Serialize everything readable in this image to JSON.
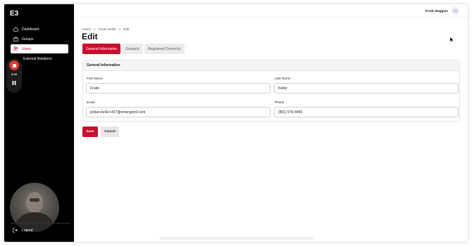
{
  "app": {
    "logo_text": "E3"
  },
  "sidebar": {
    "items": [
      {
        "label": "Dashboard",
        "icon": "home-icon"
      },
      {
        "label": "Groups",
        "icon": "groups-icon"
      },
      {
        "label": "Users",
        "icon": "users-icon",
        "active": true
      },
      {
        "label": "External Relations",
        "icon": "external-icon"
      }
    ],
    "logout_label": "Logout"
  },
  "recorder": {
    "time": "0:20"
  },
  "header": {
    "user_name": "Frodo Baggins",
    "avatar_initials": "FB"
  },
  "breadcrumb": [
    "Users",
    ">",
    "Frodo Keller",
    ">",
    "Edit"
  ],
  "page_title": "Edit",
  "tabs": [
    {
      "label": "General Information",
      "active": true
    },
    {
      "label": "Group(s)"
    },
    {
      "label": "Registered Device(s)"
    }
  ],
  "form": {
    "section_title": "General Information",
    "first_name": {
      "label": "First Name",
      "value": "Frodo"
    },
    "last_name": {
      "label": "Last Name",
      "value": "Keller"
    },
    "email": {
      "label": "Email",
      "value": "jordan.keller+427@emergent3.com"
    },
    "phone": {
      "label": "Phone",
      "value": "(801) 979-4469"
    }
  },
  "actions": {
    "save_label": "Save",
    "cancel_label": "Cancel"
  },
  "colors": {
    "accent": "#c8102e",
    "sidebar_bg": "#000000"
  }
}
